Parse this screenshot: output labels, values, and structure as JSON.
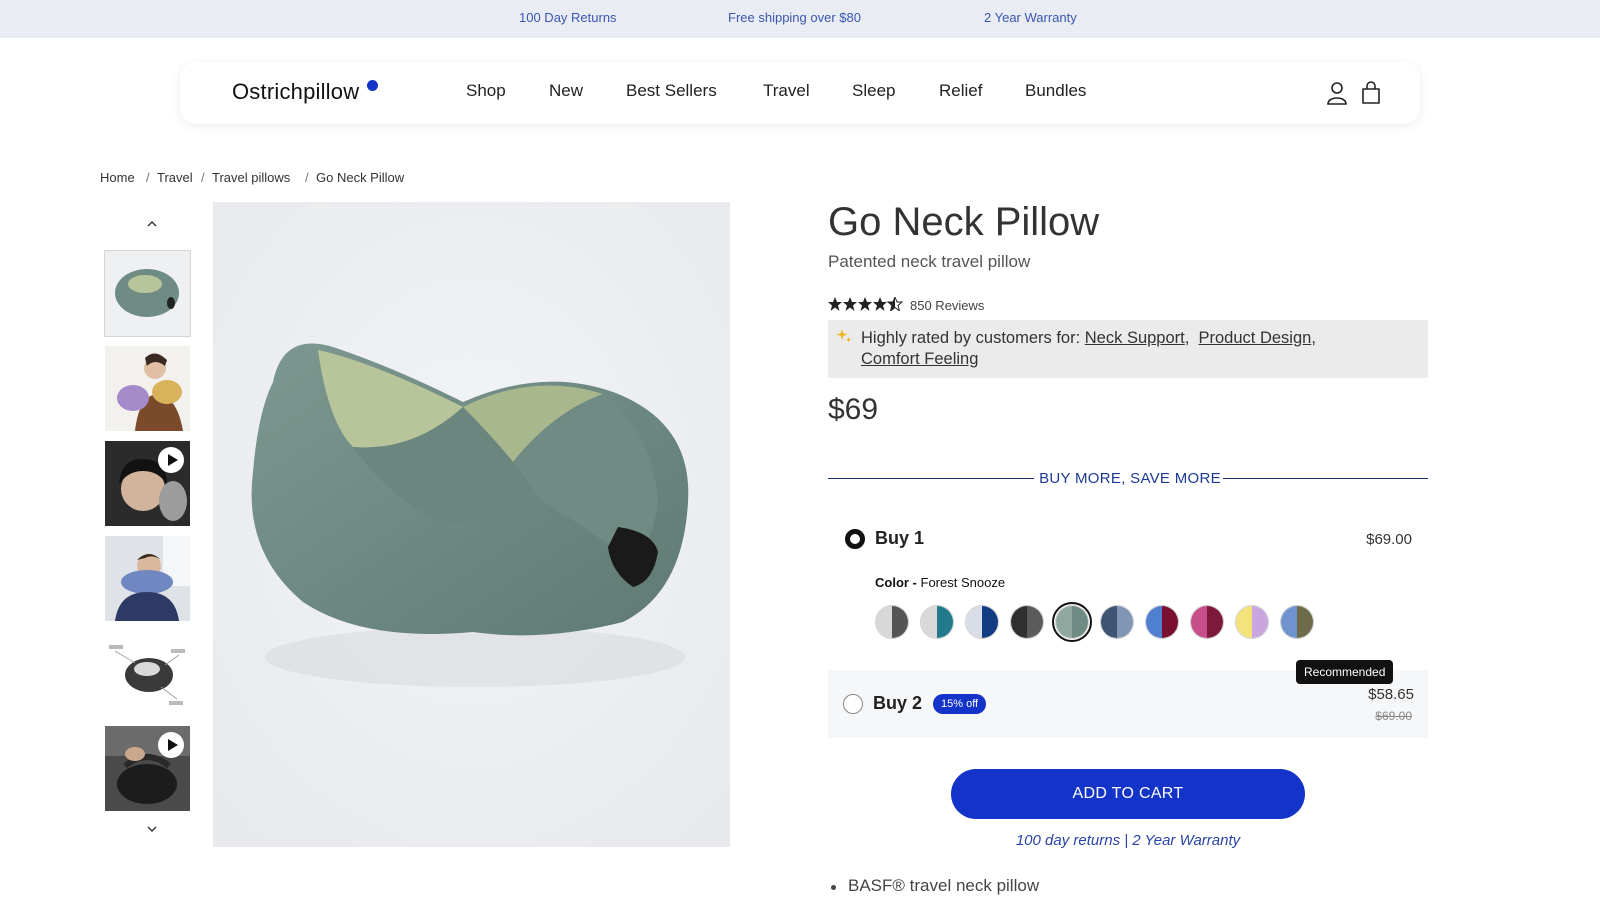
{
  "announcement": {
    "items": [
      "100 Day Returns",
      "Free shipping over $80",
      "2 Year Warranty"
    ]
  },
  "header": {
    "logo": "Ostrichpillow",
    "nav": [
      "Shop",
      "New",
      "Best Sellers",
      "Travel",
      "Sleep",
      "Relief",
      "Bundles"
    ],
    "icons": [
      "account-icon",
      "cart-icon"
    ]
  },
  "breadcrumb": [
    "Home",
    "Travel",
    "Travel pillows",
    "Go Neck Pillow"
  ],
  "gallery": {
    "thumbnails": [
      {
        "kind": "image",
        "icon": "neck-pillow-thumbnail"
      },
      {
        "kind": "image",
        "icon": "woman-with-pillows-thumbnail"
      },
      {
        "kind": "video",
        "icon": "sleeping-woman-video-thumbnail"
      },
      {
        "kind": "image",
        "icon": "man-wearing-pillow-thumbnail"
      },
      {
        "kind": "image",
        "icon": "pillow-diagram-thumbnail"
      },
      {
        "kind": "video",
        "icon": "travel-bag-video-thumbnail"
      }
    ]
  },
  "product": {
    "title": "Go Neck Pillow",
    "subtitle": "Patented neck travel pillow",
    "rating": 4.5,
    "reviews": "850 Reviews",
    "highlight_prefix": "Highly rated by customers for:",
    "highlight_links": [
      "Neck Support",
      "Product Design",
      "Comfort Feeling"
    ],
    "price": "$69"
  },
  "bundles": {
    "heading": "BUY MORE, SAVE MORE",
    "option1": {
      "label": "Buy 1",
      "price": "$69.00",
      "color_label": "Color -",
      "color_value": "Forest Snooze"
    },
    "option2": {
      "label": "Buy 2",
      "discount": "15% off",
      "price": "$58.65",
      "old_price": "$69.00",
      "badge": "Recommended"
    }
  },
  "swatches": [
    {
      "left": "#d8d8d8",
      "right": "#555555",
      "selected": false
    },
    {
      "left": "#d9d9d9",
      "right": "#237a8c",
      "selected": false
    },
    {
      "left": "#d9dde5",
      "right": "#123d82",
      "selected": false
    },
    {
      "left": "#2f2f2f",
      "right": "#5b5b5b",
      "selected": false
    },
    {
      "left": "#8fa89f",
      "right": "#6f8c84",
      "selected": true
    },
    {
      "left": "#3f5373",
      "right": "#8196b5",
      "selected": false
    },
    {
      "left": "#4f7fcf",
      "right": "#7a1030",
      "selected": false
    },
    {
      "left": "#c64e8a",
      "right": "#7d1a3c",
      "selected": false
    },
    {
      "left": "#f4e27a",
      "right": "#c9a6df",
      "selected": false
    },
    {
      "left": "#6f93cf",
      "right": "#6d6b4a",
      "selected": false
    }
  ],
  "cta": {
    "add_to_cart": "ADD TO CART",
    "guarantee": "100 day returns | 2 Year Warranty"
  },
  "details": {
    "bullet1": "BASF® travel neck pillow"
  },
  "colors": {
    "accent": "#1433c9",
    "announce_bg": "#e9edf3"
  }
}
